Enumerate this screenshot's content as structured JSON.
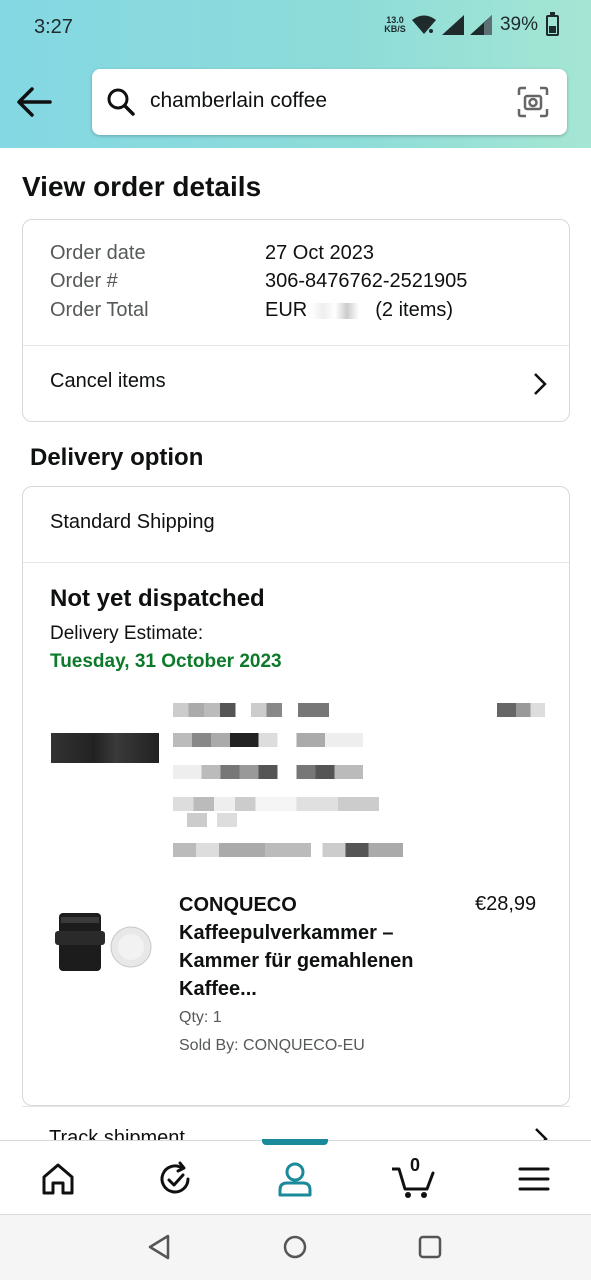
{
  "status_bar": {
    "time": "3:27",
    "net_speed_value": "13.0",
    "net_speed_unit": "KB/S",
    "battery": "39%"
  },
  "search": {
    "value": "chamberlain coffee"
  },
  "page": {
    "title": "View order details"
  },
  "order": {
    "date_label": "Order date",
    "date_value": "27 Oct 2023",
    "number_label": "Order #",
    "number_value": "306-8476762-2521905",
    "total_label": "Order Total",
    "total_prefix": "EUR",
    "total_suffix": "(2 items)",
    "cancel_label": "Cancel items"
  },
  "delivery": {
    "section_title": "Delivery option",
    "method": "Standard Shipping",
    "status": "Not yet dispatched",
    "estimate_label": "Delivery Estimate:",
    "estimate_date": "Tuesday, 31 October 2023",
    "estimate_color": "#0c7a2a"
  },
  "product": {
    "name": "CONQUECO Kaffeepulverkammer – Kammer für gemahlenen Kaffee...",
    "price": "€28,99",
    "qty": "Qty: 1",
    "seller": "Sold By: CONQUECO-EU"
  },
  "track": {
    "label": "Track shipment"
  },
  "tabbar": {
    "items": [
      "home-icon",
      "refresh-icon",
      "account-icon",
      "cart-icon",
      "menu-icon"
    ],
    "active": "account",
    "cart_count": "0",
    "accent": "#1a8a9a"
  },
  "system_nav": [
    "back",
    "home",
    "recents"
  ]
}
